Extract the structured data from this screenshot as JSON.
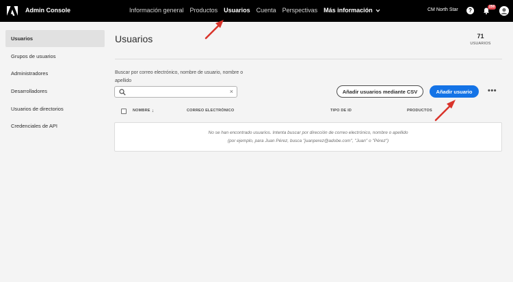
{
  "app": {
    "title": "Admin Console"
  },
  "nav": {
    "items": [
      {
        "label": "Información general",
        "active": false
      },
      {
        "label": "Productos",
        "active": false
      },
      {
        "label": "Usuarios",
        "active": true
      },
      {
        "label": "Cuenta",
        "active": false
      },
      {
        "label": "Perspectivas",
        "active": false
      }
    ],
    "more_label": "Más información"
  },
  "header_right": {
    "org_name": "CM North Star",
    "help_glyph": "?",
    "notification_count": "250",
    "icons": [
      "help-icon",
      "bell-icon",
      "avatar"
    ]
  },
  "sidebar": {
    "items": [
      {
        "label": "Usuarios",
        "active": true
      },
      {
        "label": "Grupos de usuarios",
        "active": false
      },
      {
        "label": "Administradores",
        "active": false
      },
      {
        "label": "Desarrolladores",
        "active": false
      },
      {
        "label": "Usuarios de directorios",
        "active": false
      },
      {
        "label": "Credenciales de API",
        "active": false
      }
    ]
  },
  "main": {
    "title": "Usuarios",
    "count": "71",
    "count_label": "USUARIOS",
    "search": {
      "label": "Buscar por correo electrónico, nombre de usuario, nombre o apellido",
      "value": "",
      "placeholder": ""
    },
    "buttons": {
      "bulk_add": "Añadir usuarios mediante CSV",
      "add_user": "Añadir usuario",
      "more": "•••"
    },
    "table": {
      "columns": [
        "NOMBRE",
        "CORREO ELECTRÓNICO",
        "TIPO DE ID",
        "PRODUCTOS"
      ],
      "sort_column": "NOMBRE",
      "empty_message": "No se han encontrado usuarios. Intenta buscar por dirección de correo electrónico, nombre o apellido (por ejemplo, para Juan Pérez, busca \"juanperez@adobe.com\", \"Juan\" o \"Pérez\")"
    }
  },
  "colors": {
    "topbar": "#000000",
    "primary": "#1473e6",
    "annotation_arrow": "#d9342b",
    "badge": "#e34850"
  }
}
